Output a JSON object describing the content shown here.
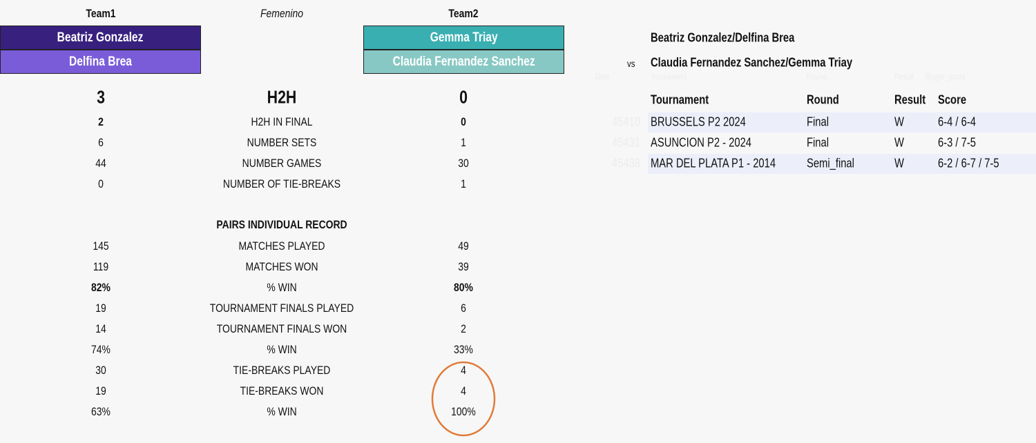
{
  "header": {
    "team1": "Team1",
    "category": "Femenino",
    "team2": "Team2"
  },
  "team1": {
    "player1": "Beatriz Gonzalez",
    "player2": "Delfina Brea",
    "color1": "#38207f",
    "color2": "#7a5cd9"
  },
  "team2": {
    "player1": "Gemma Triay",
    "player2": "Claudia Fernandez Sanchez",
    "color1": "#3aafb2",
    "color2": "#88c8c4"
  },
  "h2h": {
    "label": "H2H",
    "team1": "3",
    "team2": "0"
  },
  "h2h_stats": [
    {
      "label": "H2H IN FINAL",
      "team1": "2",
      "team2": "0"
    },
    {
      "label": "NUMBER SETS",
      "team1": "6",
      "team2": "1"
    },
    {
      "label": "NUMBER GAMES",
      "team1": "44",
      "team2": "30"
    },
    {
      "label": "NUMBER OF TIE-BREAKS",
      "team1": "0",
      "team2": "1"
    }
  ],
  "pairs_title": "PAIRS INDIVIDUAL RECORD",
  "pairs_stats": [
    {
      "label": "MATCHES PLAYED",
      "team1": "145",
      "team2": "49"
    },
    {
      "label": "MATCHES WON",
      "team1": "119",
      "team2": "39"
    },
    {
      "label": "% WIN",
      "team1": "82%",
      "team2": "80%"
    },
    {
      "label": "TOURNAMENT FINALS PLAYED",
      "team1": "19",
      "team2": "6"
    },
    {
      "label": "TOURNAMENT FINALS WON",
      "team1": "14",
      "team2": "2"
    },
    {
      "label": "% WIN",
      "team1": "74%",
      "team2": "33%"
    },
    {
      "label": "TIE-BREAKS PLAYED",
      "team1": "30",
      "team2": "4"
    },
    {
      "label": "TIE-BREAKS WON",
      "team1": "19",
      "team2": "4"
    },
    {
      "label": "% WIN",
      "team1": "63%",
      "team2": "100%"
    }
  ],
  "matchup": {
    "pair1": "Beatriz Gonzalez/Delfina Brea",
    "vs": "vs",
    "pair2": "Claudia Fernandez Sanchez/Gemma Triay"
  },
  "hidden_headers": [
    "Date",
    "Tournament",
    "Round",
    "Result",
    "Bigger_score"
  ],
  "table": {
    "headers": [
      "Tournament",
      "Round",
      "Result",
      "Score"
    ],
    "rows": [
      {
        "date": "45410",
        "tournament": "BRUSSELS P2 2024",
        "round": "Final",
        "result": "W",
        "score": "6-4 / 6-4"
      },
      {
        "date": "45431",
        "tournament": "ASUNCION P2 - 2024",
        "round": "Final",
        "result": "W",
        "score": "6-3 / 7-5"
      },
      {
        "date": "45438",
        "tournament": "MAR DEL PLATA P1 - 2014",
        "round": "Semi_final",
        "result": "W",
        "score": "6-2 / 6-7 / 7-5"
      }
    ]
  },
  "annotation_color": "#e07b39"
}
